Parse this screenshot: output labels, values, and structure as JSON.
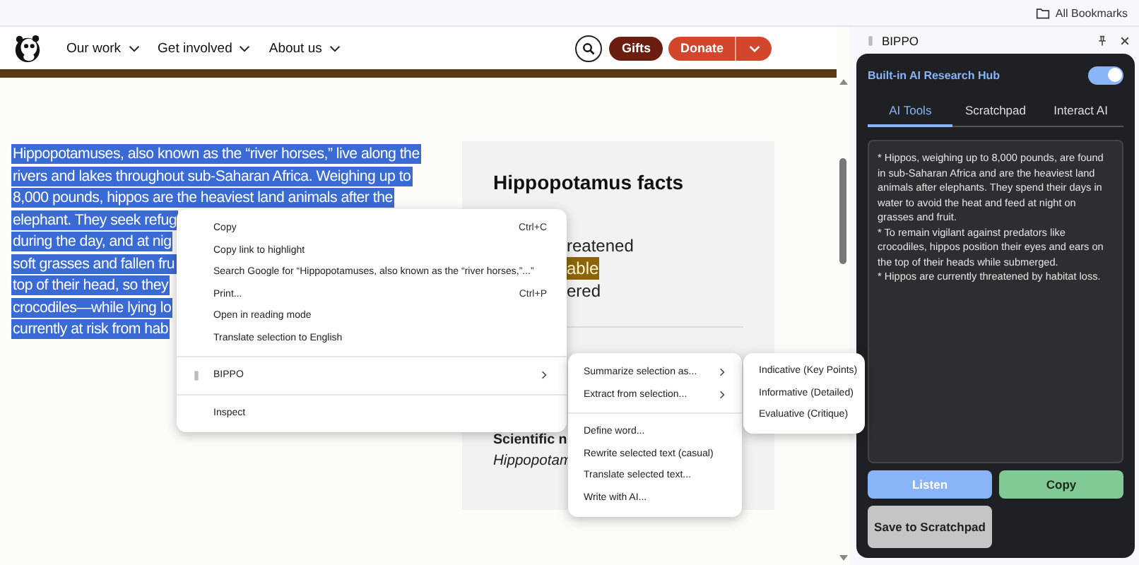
{
  "bookmarks_bar": {
    "label": "All Bookmarks"
  },
  "site_nav": {
    "items": [
      "Our work",
      "Get involved",
      "About us"
    ],
    "gifts": "Gifts",
    "donate": "Donate"
  },
  "article": {
    "lines": [
      "Hippopotamuses, also known as the “river horses,” live along the",
      "rivers and lakes throughout sub-Saharan Africa. Weighing up to",
      "8,000 pounds, hippos are the heaviest land animals after the",
      "elephant. They seek refug",
      "during the day, and at nig",
      "soft grasses and fallen fru",
      "top of their head, so they",
      "crocodiles—while lying lo",
      "currently at risk from hab"
    ]
  },
  "facts_card": {
    "title": "Hippopotamus facts",
    "status": [
      {
        "text": "reatened",
        "highlighted": false
      },
      {
        "text": "able",
        "highlighted": true
      },
      {
        "text": "ered",
        "highlighted": false
      }
    ],
    "scientific_label": "Scientific n",
    "scientific_value": "Hippopotam"
  },
  "context_menu": {
    "groups": [
      [
        {
          "label": "Copy",
          "shortcut": "Ctrl+C"
        },
        {
          "label": "Copy link to highlight"
        },
        {
          "label": "Search Google for “Hippopotamuses, also known as the “river horses,”...”"
        },
        {
          "label": "Print...",
          "shortcut": "Ctrl+P"
        },
        {
          "label": "Open in reading mode"
        },
        {
          "label": "Translate selection to English"
        }
      ],
      [
        {
          "label": "BIPPO",
          "has_submenu": true,
          "kind": "extension"
        }
      ],
      [
        {
          "label": "Inspect"
        }
      ]
    ]
  },
  "submenu": {
    "groups": [
      [
        {
          "label": "Summarize selection as...",
          "has_submenu": true
        },
        {
          "label": "Extract from selection...",
          "has_submenu": true
        }
      ],
      [
        {
          "label": "Define word..."
        },
        {
          "label": "Rewrite selected text (casual)"
        },
        {
          "label": "Translate selected text..."
        },
        {
          "label": "Write with AI..."
        }
      ]
    ]
  },
  "summary_submenu": {
    "items": [
      "Indicative (Key Points)",
      "Informative (Detailed)",
      "Evaluative (Critique)"
    ]
  },
  "side_panel": {
    "title": "BIPPO",
    "card": {
      "title": "Built-in AI Research Hub",
      "toggle_on": true,
      "tabs": [
        {
          "label": "AI Tools",
          "selected": true
        },
        {
          "label": "Scratchpad",
          "selected": false
        },
        {
          "label": "Interact AI",
          "selected": false
        }
      ],
      "output": [
        "* Hippos, weighing up to 8,000 pounds, are found in sub-Saharan Africa and are the heaviest land animals after elephants. They spend their days in water to avoid the heat and feed at night on grasses and fruit.",
        "* To remain vigilant against predators like crocodiles, hippos position their eyes and ears on the top of their heads while submerged.",
        "* Hippos are currently threatened by habitat loss."
      ],
      "buttons": [
        {
          "label": "Listen",
          "kind": "listen"
        },
        {
          "label": "Copy",
          "kind": "copy"
        },
        {
          "label": "Save to Scratchpad",
          "kind": "save"
        }
      ]
    }
  }
}
